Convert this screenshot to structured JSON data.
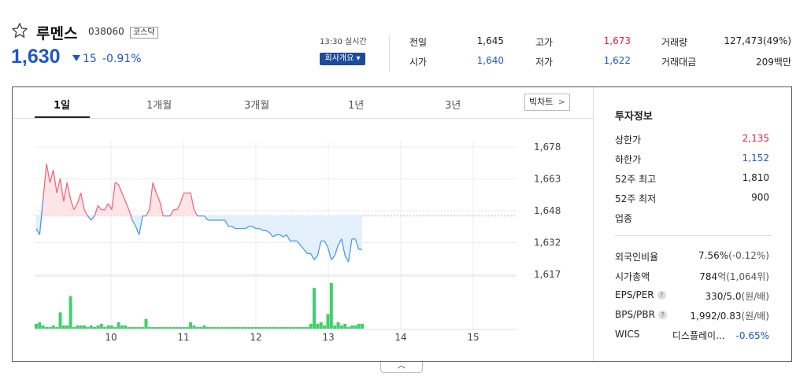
{
  "header": {
    "star_icon": "star-outline-icon",
    "name": "루멘스",
    "code": "038060",
    "market": "코스닥",
    "price": "1,630",
    "change": "15",
    "change_dir": "down",
    "change_pct": "-0.91%",
    "realtime": "13:30 실시간",
    "company_button": "회사개요 ▾"
  },
  "quotes": [
    {
      "label": "전일",
      "value": "1,645",
      "color": "#222222"
    },
    {
      "label": "시가",
      "value": "1,640",
      "color": "#1f56c8"
    },
    {
      "label": "고가",
      "value": "1,673",
      "color": "#e0243f"
    },
    {
      "label": "저가",
      "value": "1,622",
      "color": "#1f56c8"
    },
    {
      "label": "거래량",
      "value": "127,473(49%)",
      "color": "#222222"
    },
    {
      "label": "거래대금",
      "value": "209백만",
      "color": "#222222"
    }
  ],
  "tabs": [
    "1일",
    "1개월",
    "3개월",
    "1년",
    "3년"
  ],
  "active_tab": "1일",
  "big_chart": "빅차트",
  "big_chart_arrow": ">",
  "info": {
    "title": "투자정보",
    "rows1": [
      {
        "label": "상한가",
        "value": "2,135",
        "color": "#e0243f"
      },
      {
        "label": "하한가",
        "value": "1,152",
        "color": "#1f56c8"
      },
      {
        "label": "52주 최고",
        "value": "1,810",
        "color": "#222222"
      },
      {
        "label": "52주 최저",
        "value": "900",
        "color": "#222222"
      },
      {
        "label": "업종",
        "value": "",
        "color": "#222222"
      }
    ],
    "rows2": [
      {
        "label": "외국인비율",
        "value": "7.56%",
        "sub": "(-0.12%)",
        "help": false
      },
      {
        "label": "시가총액",
        "value": "784",
        "sub": "억(1,064위)",
        "help": false
      },
      {
        "label": "EPS/PER",
        "value": "330/5.0",
        "sub": "(원/배)",
        "help": true
      },
      {
        "label": "BPS/PBR",
        "value": "1,992/0.83",
        "sub": "(원/배)",
        "help": true
      },
      {
        "label": "WICS",
        "value": "디스플레이...",
        "sub": "-0.65%",
        "help": false
      }
    ]
  },
  "toggle_icon": "chevron-up-icon",
  "colors": {
    "up": "#e0243f",
    "down": "#1f56c8",
    "line_up": "#f06a7a",
    "line_down": "#4b9be8",
    "volume": "#3fd06a"
  },
  "chart_data": {
    "type": "line",
    "title": "",
    "x_ticks": [
      "10",
      "11",
      "12",
      "13",
      "14",
      "15"
    ],
    "y_ticks": [
      "1,678",
      "1,663",
      "1,648",
      "1,632",
      "1,617"
    ],
    "ylim": [
      1617,
      1678
    ],
    "baseline": 1645,
    "price_series": [
      1639,
      1636,
      1653,
      1670,
      1661,
      1667,
      1656,
      1663,
      1652,
      1661,
      1653,
      1648,
      1651,
      1656,
      1648,
      1645,
      1643,
      1645,
      1650,
      1648,
      1648,
      1651,
      1648,
      1661,
      1660,
      1656,
      1652,
      1648,
      1643,
      1640,
      1636,
      1645,
      1645,
      1648,
      1661,
      1656,
      1652,
      1645,
      1645,
      1645,
      1648,
      1648,
      1651,
      1656,
      1656,
      1656,
      1648,
      1645,
      1645,
      1645,
      1643,
      1643,
      1643,
      1643,
      1643,
      1643,
      1640,
      1640,
      1639,
      1639,
      1639,
      1639,
      1640,
      1640,
      1639,
      1639,
      1638,
      1638,
      1637,
      1635,
      1636,
      1636,
      1635,
      1636,
      1633,
      1633,
      1633,
      1631,
      1629,
      1627,
      1627,
      1624,
      1626,
      1633,
      1633,
      1630,
      1624,
      1626,
      1631,
      1634,
      1626,
      1623,
      1634,
      1634,
      1629,
      1629
    ],
    "volume_series": [
      3,
      4,
      2,
      1,
      1,
      2,
      1,
      10,
      2,
      2,
      20,
      1,
      2,
      2,
      2,
      1,
      2,
      1,
      2,
      3,
      1,
      2,
      2,
      1,
      4,
      2,
      2,
      1,
      1,
      1,
      1,
      1,
      6,
      1,
      1,
      1,
      1,
      1,
      1,
      1,
      1,
      1,
      1,
      1,
      1,
      4,
      2,
      1,
      1,
      2,
      1,
      1,
      1,
      1,
      1,
      1,
      1,
      1,
      1,
      1,
      1,
      1,
      1,
      1,
      1,
      1,
      1,
      1,
      1,
      1,
      1,
      1,
      1,
      1,
      1,
      1,
      1,
      1,
      1,
      1,
      3,
      25,
      3,
      4,
      2,
      9,
      28,
      2,
      4,
      2,
      3,
      1,
      2,
      2,
      3,
      3
    ]
  }
}
